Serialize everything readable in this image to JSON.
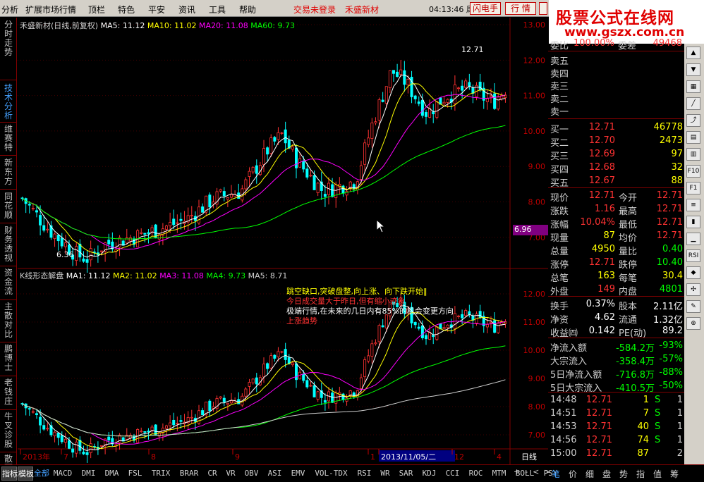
{
  "menu": {
    "items": [
      "分析",
      "扩展市场行情",
      "顶栏",
      "特色",
      "平安",
      "资讯",
      "工具",
      "帮助"
    ],
    "trade_status": "交易未登录",
    "stock_name": "禾盛新材",
    "time": "04:13:46",
    "weekday": "周二",
    "flash_btn": "闪电手",
    "quote_btn": "行 情"
  },
  "watermark": {
    "line1": "股票公式在线网",
    "line2": "www.gszx.com.cn"
  },
  "left_tabs": [
    "分时走势",
    "技术分析",
    "维赛特",
    "新东方",
    "同花顺",
    "财务透视",
    "资金流",
    "主散对比",
    "鹏博士",
    "老钱庄",
    "牛叉诊股",
    "散死"
  ],
  "main_chart": {
    "title": "禾盛新材(日线,前复权)",
    "ma": [
      {
        "label": "MA5:",
        "value": "11.12"
      },
      {
        "label": "MA10:",
        "value": "11.02"
      },
      {
        "label": "MA20:",
        "value": "11.08"
      },
      {
        "label": "MA60:",
        "value": "9.73"
      }
    ],
    "high_label": "12.71",
    "low_label": "6.36",
    "price_tag": "6.96"
  },
  "indicator_chart": {
    "title": "K线形态解盘",
    "ma": [
      {
        "label": "MA1:",
        "value": "11.12"
      },
      {
        "label": "MA2:",
        "value": "11.02"
      },
      {
        "label": "MA3:",
        "value": "11.08"
      },
      {
        "label": "MA4:",
        "value": "9.73"
      },
      {
        "label": "MA5:",
        "value": "8.71"
      }
    ],
    "notes": [
      "跳空缺口,突破盘整,向上涨、向下跌开始‖",
      "今日成交量大于昨日,但有缩小迹象",
      "极端行情,在未来的几日内有85%的机会变更方向",
      "上涨趋势"
    ]
  },
  "chart_data": [
    {
      "type": "candlestick",
      "name": "main",
      "yticks": [
        "13.00",
        "12.00",
        "11.00",
        "10.00",
        "9.00",
        "8.00",
        "7.00"
      ],
      "ylim": [
        6.2,
        13.2
      ]
    },
    {
      "type": "candlestick",
      "name": "indicator",
      "yticks": [
        "12.00",
        "11.00",
        "10.00",
        "9.00",
        "8.00",
        "7.00"
      ],
      "ylim": [
        6.6,
        12.5
      ]
    }
  ],
  "xaxis": {
    "labels": [
      "2013年",
      "7",
      "8",
      "9",
      "1",
      "2013/11/05/二",
      "12",
      "4"
    ],
    "period": "日线"
  },
  "bottom_tabs": [
    "指标",
    "模板",
    "全部",
    "MACD",
    "DMI",
    "DMA",
    "FSL",
    "TRIX",
    "BRAR",
    "CR",
    "VR",
    "OBV",
    "ASI",
    "EMV",
    "VOL-TDX",
    "RSI",
    "WR",
    "SAR",
    "KDJ",
    "CCI",
    "ROC",
    "MTM",
    "BOLL",
    "PSY"
  ],
  "bottom_right_tabs": [
    "笔",
    "价",
    "细",
    "盘",
    "势",
    "指",
    "值",
    "筹"
  ],
  "quote": {
    "wb_top": {
      "l1": "委比",
      "v1": "100.00%",
      "l2": "委差",
      "v2": "49468"
    },
    "sell": [
      {
        "l": "卖五",
        "p": "",
        "v": ""
      },
      {
        "l": "卖四",
        "p": "",
        "v": ""
      },
      {
        "l": "卖三",
        "p": "",
        "v": ""
      },
      {
        "l": "卖二",
        "p": "",
        "v": ""
      },
      {
        "l": "卖一",
        "p": "",
        "v": ""
      }
    ],
    "buy": [
      {
        "l": "买一",
        "p": "12.71",
        "v": "46778"
      },
      {
        "l": "买二",
        "p": "12.70",
        "v": "2473"
      },
      {
        "l": "买三",
        "p": "12.69",
        "v": "97"
      },
      {
        "l": "买四",
        "p": "12.68",
        "v": "32"
      },
      {
        "l": "买五",
        "p": "12.67",
        "v": "88"
      }
    ],
    "stats": [
      {
        "l1": "现价",
        "v1": "12.71",
        "l2": "今开",
        "v2": "12.71"
      },
      {
        "l1": "涨跌",
        "v1": "1.16",
        "l2": "最高",
        "v2": "12.71"
      },
      {
        "l1": "涨幅",
        "v1": "10.04%",
        "l2": "最低",
        "v2": "12.71"
      },
      {
        "l1": "现量",
        "v1": "87",
        "l2": "均价",
        "v2": "12.71"
      },
      {
        "l1": "总量",
        "v1": "4950",
        "l2": "量比",
        "v2": "0.40"
      },
      {
        "l1": "涨停",
        "v1": "12.71",
        "l2": "跌停",
        "v2": "10.40"
      },
      {
        "l1": "总笔",
        "v1": "163",
        "l2": "每笔",
        "v2": "30.4"
      },
      {
        "l1": "外盘",
        "v1": "149",
        "l2": "内盘",
        "v2": "4801"
      }
    ],
    "stats2": [
      {
        "l1": "换手",
        "v1": "0.37%",
        "l2": "股本",
        "v2": "2.11亿"
      },
      {
        "l1": "净资",
        "v1": "4.62",
        "l2": "流通",
        "v2": "1.32亿"
      },
      {
        "l1": "收益㈣",
        "v1": "0.142",
        "l2": "PE(动)",
        "v2": "89.2"
      }
    ],
    "flows": [
      {
        "l": "净流入额",
        "v": "-584.2万",
        "p": "-93%"
      },
      {
        "l": "大宗流入",
        "v": "-358.4万",
        "p": "-57%"
      },
      {
        "l": "5日净流入额",
        "v": "-716.8万",
        "p": "-88%"
      },
      {
        "l": "5日大宗流入",
        "v": "-410.5万",
        "p": "-50%"
      }
    ],
    "ticks": [
      {
        "t": "14:48",
        "p": "12.71",
        "v": "1",
        "s": "S",
        "n": "1"
      },
      {
        "t": "14:51",
        "p": "12.71",
        "v": "7",
        "s": "S",
        "n": "1"
      },
      {
        "t": "14:53",
        "p": "12.71",
        "v": "40",
        "s": "S",
        "n": "1"
      },
      {
        "t": "14:56",
        "p": "12.71",
        "v": "74",
        "s": "S",
        "n": "1"
      },
      {
        "t": "15:00",
        "p": "12.71",
        "v": "87",
        "s": "",
        "n": "2"
      }
    ]
  },
  "colors": {
    "up": "#ff3232",
    "down": "#00ffff",
    "ma5": "#ffffff",
    "ma10": "#ffff00",
    "ma20": "#ff00ff",
    "ma60": "#00ff00",
    "border": "#800000"
  }
}
